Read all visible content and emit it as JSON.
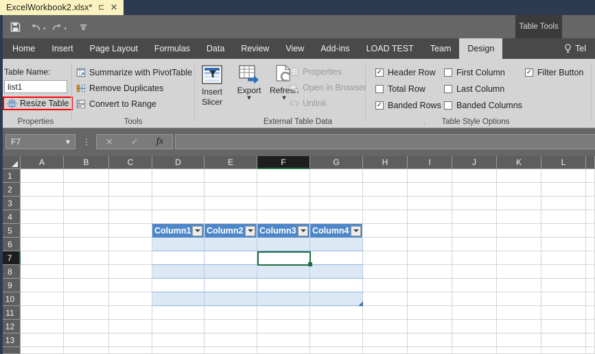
{
  "titlebar": {
    "document_name": "ExcelWorkbook2.xlsx*",
    "pin_icon": "pin-icon",
    "close_icon": "close-icon"
  },
  "quick_access": {
    "save_label": "Save",
    "undo_label": "Undo",
    "redo_label": "Redo",
    "customize_label": "Customize Quick Access Toolbar",
    "caret": "▾"
  },
  "contextual": {
    "label": "Table Tools"
  },
  "tabs": [
    {
      "label": "Home",
      "active": false
    },
    {
      "label": "Insert",
      "active": false
    },
    {
      "label": "Page Layout",
      "active": false
    },
    {
      "label": "Formulas",
      "active": false
    },
    {
      "label": "Data",
      "active": false
    },
    {
      "label": "Review",
      "active": false
    },
    {
      "label": "View",
      "active": false
    },
    {
      "label": "Add-ins",
      "active": false
    },
    {
      "label": "LOAD TEST",
      "active": false
    },
    {
      "label": "Team",
      "active": false
    },
    {
      "label": "Design",
      "active": true
    }
  ],
  "tellme": {
    "label": "Tel",
    "icon": "lightbulb-icon"
  },
  "ribbon": {
    "groups": [
      {
        "name": "properties",
        "title": "Properties"
      },
      {
        "name": "tools",
        "title": "Tools"
      },
      {
        "name": "external_table_data",
        "title": "External Table Data"
      },
      {
        "name": "table_style_options",
        "title": "Table Style Options"
      }
    ],
    "properties": {
      "table_name_label": "Table Name:",
      "table_name_value": "list1",
      "resize_table_label": "Resize Table",
      "resize_table_highlight_color": "#ff0000"
    },
    "tools": [
      {
        "label": "Summarize with PivotTable",
        "icon": "pivottable-icon"
      },
      {
        "label": "Remove Duplicates",
        "icon": "remove-duplicates-icon"
      },
      {
        "label": "Convert to Range",
        "icon": "convert-range-icon"
      }
    ],
    "external": {
      "insert_slicer_line1": "Insert",
      "insert_slicer_line2": "Slicer",
      "export_label": "Export",
      "refresh_label": "Refresh",
      "disabled_items": [
        {
          "label": "Properties",
          "icon": "properties-icon"
        },
        {
          "label": "Open in Browser",
          "icon": "open-in-browser-icon"
        },
        {
          "label": "Unlink",
          "icon": "unlink-icon"
        }
      ]
    },
    "style_options": [
      {
        "label": "Header Row",
        "checked": true
      },
      {
        "label": "Total Row",
        "checked": false
      },
      {
        "label": "Banded Rows",
        "checked": true
      },
      {
        "label": "First Column",
        "checked": false
      },
      {
        "label": "Last Column",
        "checked": false
      },
      {
        "label": "Banded Columns",
        "checked": false
      },
      {
        "label": "Filter Button",
        "checked": true
      }
    ]
  },
  "formula_bar": {
    "name_box_value": "F7",
    "name_box_caret": "▼",
    "cancel_icon": "×",
    "enter_icon": "✓",
    "function_icon": "fx",
    "formula_value": ""
  },
  "grid": {
    "column_headers": [
      "A",
      "B",
      "C",
      "D",
      "E",
      "F",
      "G",
      "H",
      "I",
      "J",
      "K",
      "L"
    ],
    "row_headers": [
      "1",
      "2",
      "3",
      "4",
      "5",
      "6",
      "7",
      "8",
      "9",
      "10",
      "11",
      "12",
      "13"
    ],
    "active_column": "F",
    "active_row": "7",
    "selected_cell": "F7",
    "accent_color": "#217346",
    "table": {
      "header_row_index": 5,
      "last_row_index": 10,
      "columns": [
        "Column1",
        "Column2",
        "Column3",
        "Column4"
      ],
      "header_fill": "#4e87c7",
      "band_fill": "#dce9f5",
      "filter_buttons": true,
      "rows": [
        {
          "row": 6,
          "banded": true,
          "cells": [
            "",
            "",
            "",
            ""
          ]
        },
        {
          "row": 7,
          "banded": false,
          "cells": [
            "",
            "",
            "",
            ""
          ]
        },
        {
          "row": 8,
          "banded": true,
          "cells": [
            "",
            "",
            "",
            ""
          ]
        },
        {
          "row": 9,
          "banded": false,
          "cells": [
            "",
            "",
            "",
            ""
          ]
        },
        {
          "row": 10,
          "banded": true,
          "cells": [
            "",
            "",
            "",
            ""
          ]
        }
      ]
    }
  }
}
